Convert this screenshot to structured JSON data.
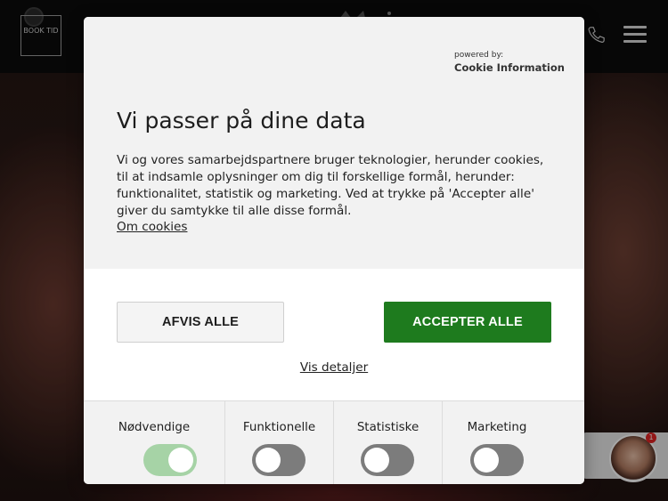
{
  "header": {
    "book_button_label": "BOOK TID",
    "icons": [
      "phone-icon",
      "menu-icon"
    ]
  },
  "dialog": {
    "powered_by": "powered by:",
    "powered_brand": "Cookie Information",
    "title": "Vi passer på dine data",
    "body": "Vi og vores samarbejdspartnere bruger teknologier, herunder cookies, til at indsamle oplysninger om dig til forskellige formål, herunder: funktionalitet, statistik og marketing. Ved at trykke på 'Accepter alle' giver du samtykke til alle disse formål.",
    "about_link": "Om cookies",
    "decline_label": "AFVIS ALLE",
    "accept_label": "ACCEPTER ALLE",
    "details_link": "Vis detaljer",
    "categories": [
      {
        "label": "Nødvendige",
        "enabled": true,
        "locked": true
      },
      {
        "label": "Funktionelle",
        "enabled": false
      },
      {
        "label": "Statistiske",
        "enabled": false
      },
      {
        "label": "Marketing",
        "enabled": false
      }
    ]
  },
  "chat": {
    "badge_count": "1"
  },
  "colors": {
    "accept": "#1e7b1e",
    "toggle_on": "#a6d3a6",
    "toggle_off": "#7c7c7c"
  }
}
